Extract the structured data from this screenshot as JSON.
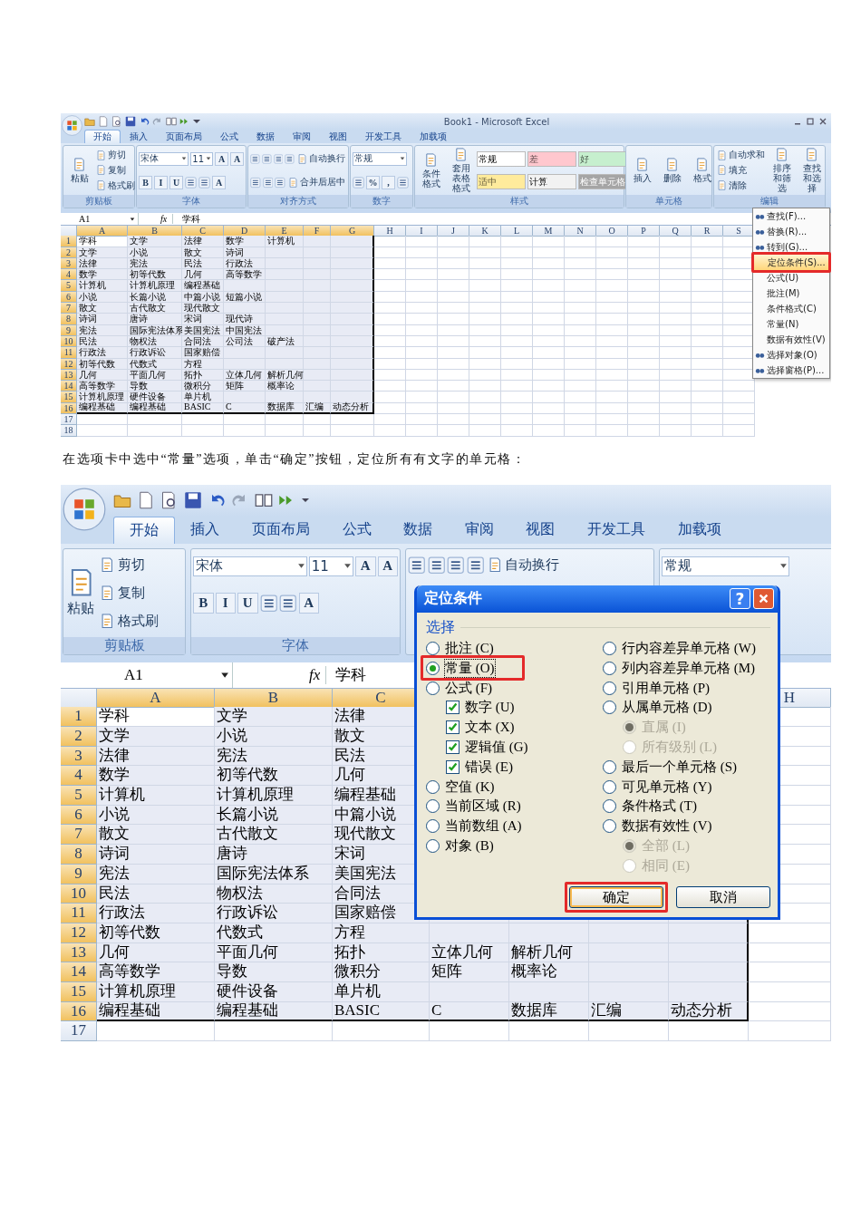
{
  "screenshot_1": {
    "title": "Book1 - Microsoft Excel",
    "tabs": [
      {
        "label": "开始",
        "selected": true
      },
      {
        "label": "插入",
        "selected": false
      },
      {
        "label": "页面布局",
        "selected": false
      },
      {
        "label": "公式",
        "selected": false
      },
      {
        "label": "数据",
        "selected": false
      },
      {
        "label": "审阅",
        "selected": false
      },
      {
        "label": "视图",
        "selected": false
      },
      {
        "label": "开发工具",
        "selected": false
      },
      {
        "label": "加载项",
        "selected": false
      }
    ],
    "ribbon": [
      {
        "label": "剪贴板",
        "stacks": [
          [
            {
              "kind": "large",
              "label": "粘贴"
            }
          ],
          [
            {
              "kind": "small",
              "label": "剪切"
            },
            {
              "kind": "small",
              "label": "复制"
            },
            {
              "kind": "small",
              "label": "格式刷"
            }
          ]
        ]
      },
      {
        "label": "字体",
        "rows": [
          [
            {
              "kind": "combo",
              "label": "宋体"
            },
            {
              "kind": "field",
              "label": "11"
            },
            {
              "kind": "glyph",
              "label": "A"
            },
            {
              "kind": "glyph",
              "label": "A"
            }
          ],
          [
            {
              "kind": "glyph",
              "label": "B"
            },
            {
              "kind": "glyph",
              "label": "I"
            },
            {
              "kind": "glyph",
              "label": "U"
            },
            {
              "kind": "icon"
            },
            {
              "kind": "icon"
            },
            {
              "kind": "glyph",
              "label": "A"
            }
          ]
        ]
      },
      {
        "label": "对齐方式",
        "rows": [
          [
            {
              "kind": "icon"
            },
            {
              "kind": "icon"
            },
            {
              "kind": "icon"
            },
            {
              "kind": "icon"
            },
            {
              "kind": "small",
              "label": "自动换行"
            }
          ],
          [
            {
              "kind": "icon"
            },
            {
              "kind": "icon"
            },
            {
              "kind": "icon"
            },
            {
              "kind": "small",
              "label": "合并后居中"
            }
          ]
        ]
      },
      {
        "label": "数字",
        "rows": [
          [
            {
              "kind": "combo",
              "label": "常规"
            }
          ],
          [
            {
              "kind": "icon"
            },
            {
              "kind": "glyph",
              "label": "%"
            },
            {
              "kind": "glyph",
              "label": ","
            },
            {
              "kind": "icon"
            }
          ]
        ]
      },
      {
        "label": "样式",
        "stacks": [
          [
            {
              "kind": "large",
              "label": "条件格式"
            }
          ],
          [
            {
              "kind": "large",
              "label": "套用表格格式"
            }
          ],
          [
            {
              "kind": "style",
              "label": "常规",
              "color": "#ffffff"
            },
            {
              "kind": "style",
              "label": "适中",
              "color": "#ffeb9c"
            }
          ],
          [
            {
              "kind": "style",
              "label": "差",
              "color": "#ffc7ce"
            },
            {
              "kind": "style",
              "label": "计算",
              "color": "#f2f2f2"
            }
          ],
          [
            {
              "kind": "style",
              "label": "好",
              "color": "#c6efce"
            },
            {
              "kind": "style",
              "label": "检查单元格",
              "color": "#a5a5a5"
            }
          ]
        ]
      },
      {
        "label": "单元格",
        "stacks": [
          [
            {
              "kind": "large",
              "label": "插入"
            }
          ],
          [
            {
              "kind": "large",
              "label": "删除"
            }
          ],
          [
            {
              "kind": "large",
              "label": "格式"
            }
          ]
        ]
      },
      {
        "label": "编辑",
        "stacks": [
          [
            {
              "kind": "small",
              "label": "自动求和"
            },
            {
              "kind": "small",
              "label": "填充"
            },
            {
              "kind": "small",
              "label": "清除"
            }
          ],
          [
            {
              "kind": "large",
              "label": "排序和筛选"
            }
          ],
          [
            {
              "kind": "large",
              "label": "查找和选择"
            }
          ]
        ]
      }
    ],
    "name_box": "A1",
    "function_label": "fx",
    "formula": "学科",
    "columns": [
      {
        "label": "A",
        "selected": true
      },
      {
        "label": "B",
        "selected": true
      },
      {
        "label": "C",
        "selected": true
      },
      {
        "label": "D",
        "selected": true
      },
      {
        "label": "E",
        "selected": true
      },
      {
        "label": "F",
        "selected": true
      },
      {
        "label": "G",
        "selected": true
      },
      {
        "label": "H",
        "selected": false
      },
      {
        "label": "I",
        "selected": false
      },
      {
        "label": "J",
        "selected": false
      },
      {
        "label": "K",
        "selected": false
      },
      {
        "label": "L",
        "selected": false
      },
      {
        "label": "M",
        "selected": false
      },
      {
        "label": "N",
        "selected": false
      },
      {
        "label": "O",
        "selected": false
      },
      {
        "label": "P",
        "selected": false
      },
      {
        "label": "Q",
        "selected": false
      },
      {
        "label": "R",
        "selected": false
      },
      {
        "label": "S",
        "selected": false
      }
    ],
    "rows": [
      {
        "number": "1",
        "selected": true,
        "cells": [
          "学科",
          "文学",
          "法律",
          "数学",
          "计算机"
        ]
      },
      {
        "number": "2",
        "selected": true,
        "cells": [
          "文学",
          "小说",
          "散文",
          "诗词"
        ]
      },
      {
        "number": "3",
        "selected": true,
        "cells": [
          "法律",
          "宪法",
          "民法",
          "行政法"
        ]
      },
      {
        "number": "4",
        "selected": true,
        "cells": [
          "数学",
          "初等代数",
          "几何",
          "高等数学"
        ]
      },
      {
        "number": "5",
        "selected": true,
        "cells": [
          "计算机",
          "计算机原理",
          "编程基础"
        ]
      },
      {
        "number": "6",
        "selected": true,
        "cells": [
          "小说",
          "长篇小说",
          "中篇小说",
          "短篇小说"
        ]
      },
      {
        "number": "7",
        "selected": true,
        "cells": [
          "散文",
          "古代散文",
          "现代散文"
        ]
      },
      {
        "number": "8",
        "selected": true,
        "cells": [
          "诗词",
          "唐诗",
          "宋词",
          "现代诗"
        ]
      },
      {
        "number": "9",
        "selected": true,
        "cells": [
          "宪法",
          "国际宪法体系",
          "美国宪法",
          "中国宪法"
        ]
      },
      {
        "number": "10",
        "selected": true,
        "cells": [
          "民法",
          "物权法",
          "合同法",
          "公司法",
          "破产法"
        ]
      },
      {
        "number": "11",
        "selected": true,
        "cells": [
          "行政法",
          "行政诉讼",
          "国家赔偿"
        ]
      },
      {
        "number": "12",
        "selected": true,
        "cells": [
          "初等代数",
          "代数式",
          "方程"
        ]
      },
      {
        "number": "13",
        "selected": true,
        "cells": [
          "几何",
          "平面几何",
          "拓扑",
          "立体几何",
          "解析几何"
        ]
      },
      {
        "number": "14",
        "selected": true,
        "cells": [
          "高等数学",
          "导数",
          "微积分",
          "矩阵",
          "概率论"
        ]
      },
      {
        "number": "15",
        "selected": true,
        "cells": [
          "计算机原理",
          "硬件设备",
          "单片机"
        ]
      },
      {
        "number": "16",
        "selected": true,
        "cells": [
          "编程基础",
          "编程基础",
          "BASIC",
          "C",
          "数据库",
          "汇编",
          "动态分析"
        ]
      },
      {
        "number": "17",
        "selected": false,
        "cells": []
      },
      {
        "number": "18",
        "selected": false,
        "cells": []
      }
    ],
    "menu": [
      {
        "label": "查找(F)...",
        "has_icon": true,
        "highlighted": false,
        "annotated": false
      },
      {
        "label": "替换(R)...",
        "has_icon": true,
        "highlighted": false,
        "annotated": false
      },
      {
        "label": "转到(G)...",
        "has_icon": true,
        "highlighted": false,
        "annotated": false
      },
      {
        "label": "定位条件(S)...",
        "has_icon": false,
        "highlighted": true,
        "annotated": true
      },
      {
        "label": "公式(U)",
        "has_icon": false,
        "highlighted": false,
        "annotated": false
      },
      {
        "label": "批注(M)",
        "has_icon": false,
        "highlighted": false,
        "annotated": false
      },
      {
        "label": "条件格式(C)",
        "has_icon": false,
        "highlighted": false,
        "annotated": false
      },
      {
        "label": "常量(N)",
        "has_icon": false,
        "highlighted": false,
        "annotated": false
      },
      {
        "label": "数据有效性(V)",
        "has_icon": false,
        "highlighted": false,
        "annotated": false
      },
      {
        "label": "选择对象(O)",
        "has_icon": true,
        "highlighted": false,
        "annotated": false
      },
      {
        "label": "选择窗格(P)...",
        "has_icon": true,
        "highlighted": false,
        "annotated": false
      }
    ]
  },
  "caption": "在选项卡中选中“常量”选项，单击“确定”按钮，定位所有有文字的单元格：",
  "screenshot_2": {
    "tabs": [
      {
        "label": "开始",
        "selected": true
      },
      {
        "label": "插入",
        "selected": false
      },
      {
        "label": "页面布局",
        "selected": false
      },
      {
        "label": "公式",
        "selected": false
      },
      {
        "label": "数据",
        "selected": false
      },
      {
        "label": "审阅",
        "selected": false
      },
      {
        "label": "视图",
        "selected": false
      },
      {
        "label": "开发工具",
        "selected": false
      },
      {
        "label": "加载项",
        "selected": false
      }
    ],
    "ribbon": [
      {
        "label": "剪贴板",
        "stacks": [
          [
            {
              "kind": "large",
              "label": "粘贴"
            }
          ],
          [
            {
              "kind": "small",
              "label": "剪切"
            },
            {
              "kind": "small",
              "label": "复制"
            },
            {
              "kind": "small",
              "label": "格式刷"
            }
          ]
        ]
      },
      {
        "label": "字体",
        "rows": [
          [
            {
              "kind": "combo",
              "label": "宋体"
            },
            {
              "kind": "field",
              "label": "11"
            },
            {
              "kind": "glyph",
              "label": "A"
            },
            {
              "kind": "glyph",
              "label": "A"
            }
          ],
          [
            {
              "kind": "glyph",
              "label": "B"
            },
            {
              "kind": "glyph",
              "label": "I"
            },
            {
              "kind": "glyph",
              "label": "U"
            },
            {
              "kind": "icon"
            },
            {
              "kind": "icon"
            },
            {
              "kind": "glyph",
              "label": "A"
            }
          ]
        ]
      },
      {
        "rows": [
          [
            {
              "kind": "icon"
            },
            {
              "kind": "icon"
            },
            {
              "kind": "icon"
            },
            {
              "kind": "icon"
            },
            {
              "kind": "small",
              "label": "自动换行"
            }
          ]
        ]
      },
      {
        "rows": [
          [
            {
              "kind": "combo",
              "label": "常规"
            }
          ]
        ]
      }
    ],
    "name_box": "A1",
    "function_label": "fx",
    "formula": "学科",
    "columns": [
      {
        "label": "A",
        "selected": true
      },
      {
        "label": "B",
        "selected": true
      },
      {
        "label": "C",
        "selected": true
      },
      {
        "selected": true
      },
      {
        "selected": true
      },
      {
        "selected": true
      },
      {
        "selected": true
      },
      {
        "label": "H",
        "selected": false
      }
    ],
    "rows": [
      {
        "number": "1",
        "selected": true,
        "cells": [
          "学科",
          "文学",
          "法律"
        ]
      },
      {
        "number": "2",
        "selected": true,
        "cells": [
          "文学",
          "小说",
          "散文"
        ]
      },
      {
        "number": "3",
        "selected": true,
        "cells": [
          "法律",
          "宪法",
          "民法"
        ]
      },
      {
        "number": "4",
        "selected": true,
        "cells": [
          "数学",
          "初等代数",
          "几何"
        ]
      },
      {
        "number": "5",
        "selected": true,
        "cells": [
          "计算机",
          "计算机原理",
          "编程基础"
        ]
      },
      {
        "number": "6",
        "selected": true,
        "cells": [
          "小说",
          "长篇小说",
          "中篇小说"
        ]
      },
      {
        "number": "7",
        "selected": true,
        "cells": [
          "散文",
          "古代散文",
          "现代散文"
        ]
      },
      {
        "number": "8",
        "selected": true,
        "cells": [
          "诗词",
          "唐诗",
          "宋词"
        ]
      },
      {
        "number": "9",
        "selected": true,
        "cells": [
          "宪法",
          "国际宪法体系",
          "美国宪法"
        ]
      },
      {
        "number": "10",
        "selected": true,
        "cells": [
          "民法",
          "物权法",
          "合同法"
        ]
      },
      {
        "number": "11",
        "selected": true,
        "cells": [
          "行政法",
          "行政诉讼",
          "国家赔偿"
        ]
      },
      {
        "number": "12",
        "selected": true,
        "cells": [
          "初等代数",
          "代数式",
          "方程"
        ]
      },
      {
        "number": "13",
        "selected": true,
        "cells": [
          "几何",
          "平面几何",
          "拓扑",
          "立体几何",
          "解析几何"
        ]
      },
      {
        "number": "14",
        "selected": true,
        "cells": [
          "高等数学",
          "导数",
          "微积分",
          "矩阵",
          "概率论"
        ]
      },
      {
        "number": "15",
        "selected": true,
        "cells": [
          "计算机原理",
          "硬件设备",
          "单片机"
        ]
      },
      {
        "number": "16",
        "selected": true,
        "cells": [
          "编程基础",
          "编程基础",
          "BASIC",
          "C",
          "数据库",
          "汇编",
          "动态分析"
        ]
      },
      {
        "number": "17",
        "selected": false,
        "cells": []
      }
    ],
    "dialog": {
      "title": "定位条件",
      "help": "?",
      "section": "选择",
      "left": [
        {
          "kind": "radio",
          "label": "批注 (C)",
          "selected": false,
          "disabled": false,
          "annotated": false
        },
        {
          "kind": "radio",
          "label": "常量 (O)",
          "selected": true,
          "disabled": false,
          "annotated": true
        },
        {
          "kind": "radio",
          "label": "公式 (F)",
          "selected": false,
          "disabled": false,
          "annotated": false
        },
        {
          "kind": "checkbox",
          "label": "数字 (U)",
          "checked": true
        },
        {
          "kind": "checkbox",
          "label": "文本 (X)",
          "checked": true
        },
        {
          "kind": "checkbox",
          "label": "逻辑值 (G)",
          "checked": true
        },
        {
          "kind": "checkbox",
          "label": "错误 (E)",
          "checked": true
        },
        {
          "kind": "radio",
          "label": "空值 (K)",
          "selected": false,
          "disabled": false,
          "annotated": false
        },
        {
          "kind": "radio",
          "label": "当前区域 (R)",
          "selected": false,
          "disabled": false,
          "annotated": false
        },
        {
          "kind": "radio",
          "label": "当前数组 (A)",
          "selected": false,
          "disabled": false,
          "annotated": false
        },
        {
          "kind": "radio",
          "label": "对象 (B)",
          "selected": false,
          "disabled": false,
          "annotated": false
        }
      ],
      "right": [
        {
          "kind": "radio",
          "label": "行内容差异单元格 (W)",
          "selected": false,
          "disabled": false,
          "annotated": false
        },
        {
          "kind": "radio",
          "label": "列内容差异单元格 (M)",
          "selected": false,
          "disabled": false,
          "annotated": false
        },
        {
          "kind": "radio",
          "label": "引用单元格 (P)",
          "selected": false,
          "disabled": false,
          "annotated": false
        },
        {
          "kind": "radio",
          "label": "从属单元格 (D)",
          "selected": false,
          "disabled": false,
          "annotated": false
        },
        {
          "kind": "subradio",
          "label": "直属 (I)",
          "selected": true,
          "disabled": true,
          "annotated": false
        },
        {
          "kind": "subradio",
          "label": "所有级别 (L)",
          "selected": false,
          "disabled": true,
          "annotated": false
        },
        {
          "kind": "radio",
          "label": "最后一个单元格 (S)",
          "selected": false,
          "disabled": false,
          "annotated": false
        },
        {
          "kind": "radio",
          "label": "可见单元格 (Y)",
          "selected": false,
          "disabled": false,
          "annotated": false
        },
        {
          "kind": "radio",
          "label": "条件格式 (T)",
          "selected": false,
          "disabled": false,
          "annotated": false
        },
        {
          "kind": "radio",
          "label": "数据有效性 (V)",
          "selected": false,
          "disabled": false,
          "annotated": false
        },
        {
          "kind": "subradio",
          "label": "全部 (L)",
          "selected": true,
          "disabled": true,
          "annotated": false
        },
        {
          "kind": "subradio",
          "label": "相同 (E)",
          "selected": false,
          "disabled": true,
          "annotated": false
        }
      ],
      "buttons": [
        {
          "label": "确定",
          "default": true,
          "annotated": true
        },
        {
          "label": "取消",
          "default": false,
          "annotated": false
        }
      ]
    }
  }
}
